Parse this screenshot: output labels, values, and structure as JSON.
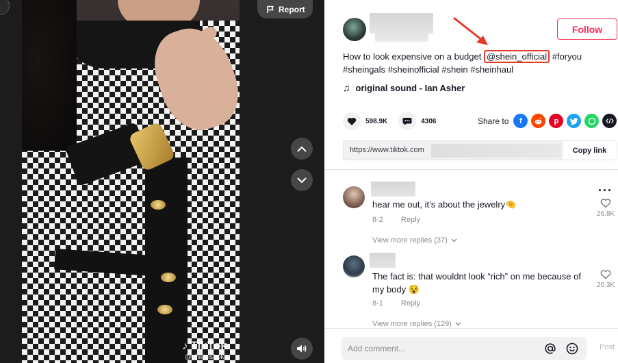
{
  "video": {
    "report_label": "Report",
    "watermark_logo": "TikTok",
    "watermark_user": "@shilanshoko"
  },
  "post": {
    "follow_label": "Follow",
    "caption_prefix": "How to look expensive on a budget ",
    "mention": "@shein_official",
    "hashtags_line1": " #foryou",
    "hashtags_line2": "#sheingals #sheinofficial #shein #sheinhaul",
    "sound": "original sound - Ian Asher",
    "likes": "598.9K",
    "comments_count": "4306",
    "share_label": "Share to",
    "share_targets": [
      "facebook-icon",
      "reddit-icon",
      "pinterest-icon",
      "twitter-icon",
      "whatsapp-icon",
      "embed-icon"
    ],
    "link_prefix": "https://www.tiktok.com",
    "copy_link_label": "Copy link"
  },
  "comments": [
    {
      "text": "hear me out, it’s about the jewelry🤏",
      "date": "8-2",
      "reply_label": "Reply",
      "likes": "26.8K",
      "view_more": "View more replies (37)"
    },
    {
      "text": "The fact is: that wouldnt look “rich” on me because of my body 😵",
      "date": "8-1",
      "reply_label": "Reply",
      "likes": "20.3K",
      "view_more": "View more replies (129)"
    }
  ],
  "composer": {
    "placeholder": "Add comment...",
    "post_label": "Post"
  },
  "colors": {
    "brand": "#fe2c55",
    "annotation": "#e23a28",
    "facebook": "#1877f2",
    "reddit": "#ff4500",
    "pinterest": "#e60023",
    "twitter": "#1da1f2",
    "whatsapp": "#25d366",
    "embed": "#161823"
  }
}
